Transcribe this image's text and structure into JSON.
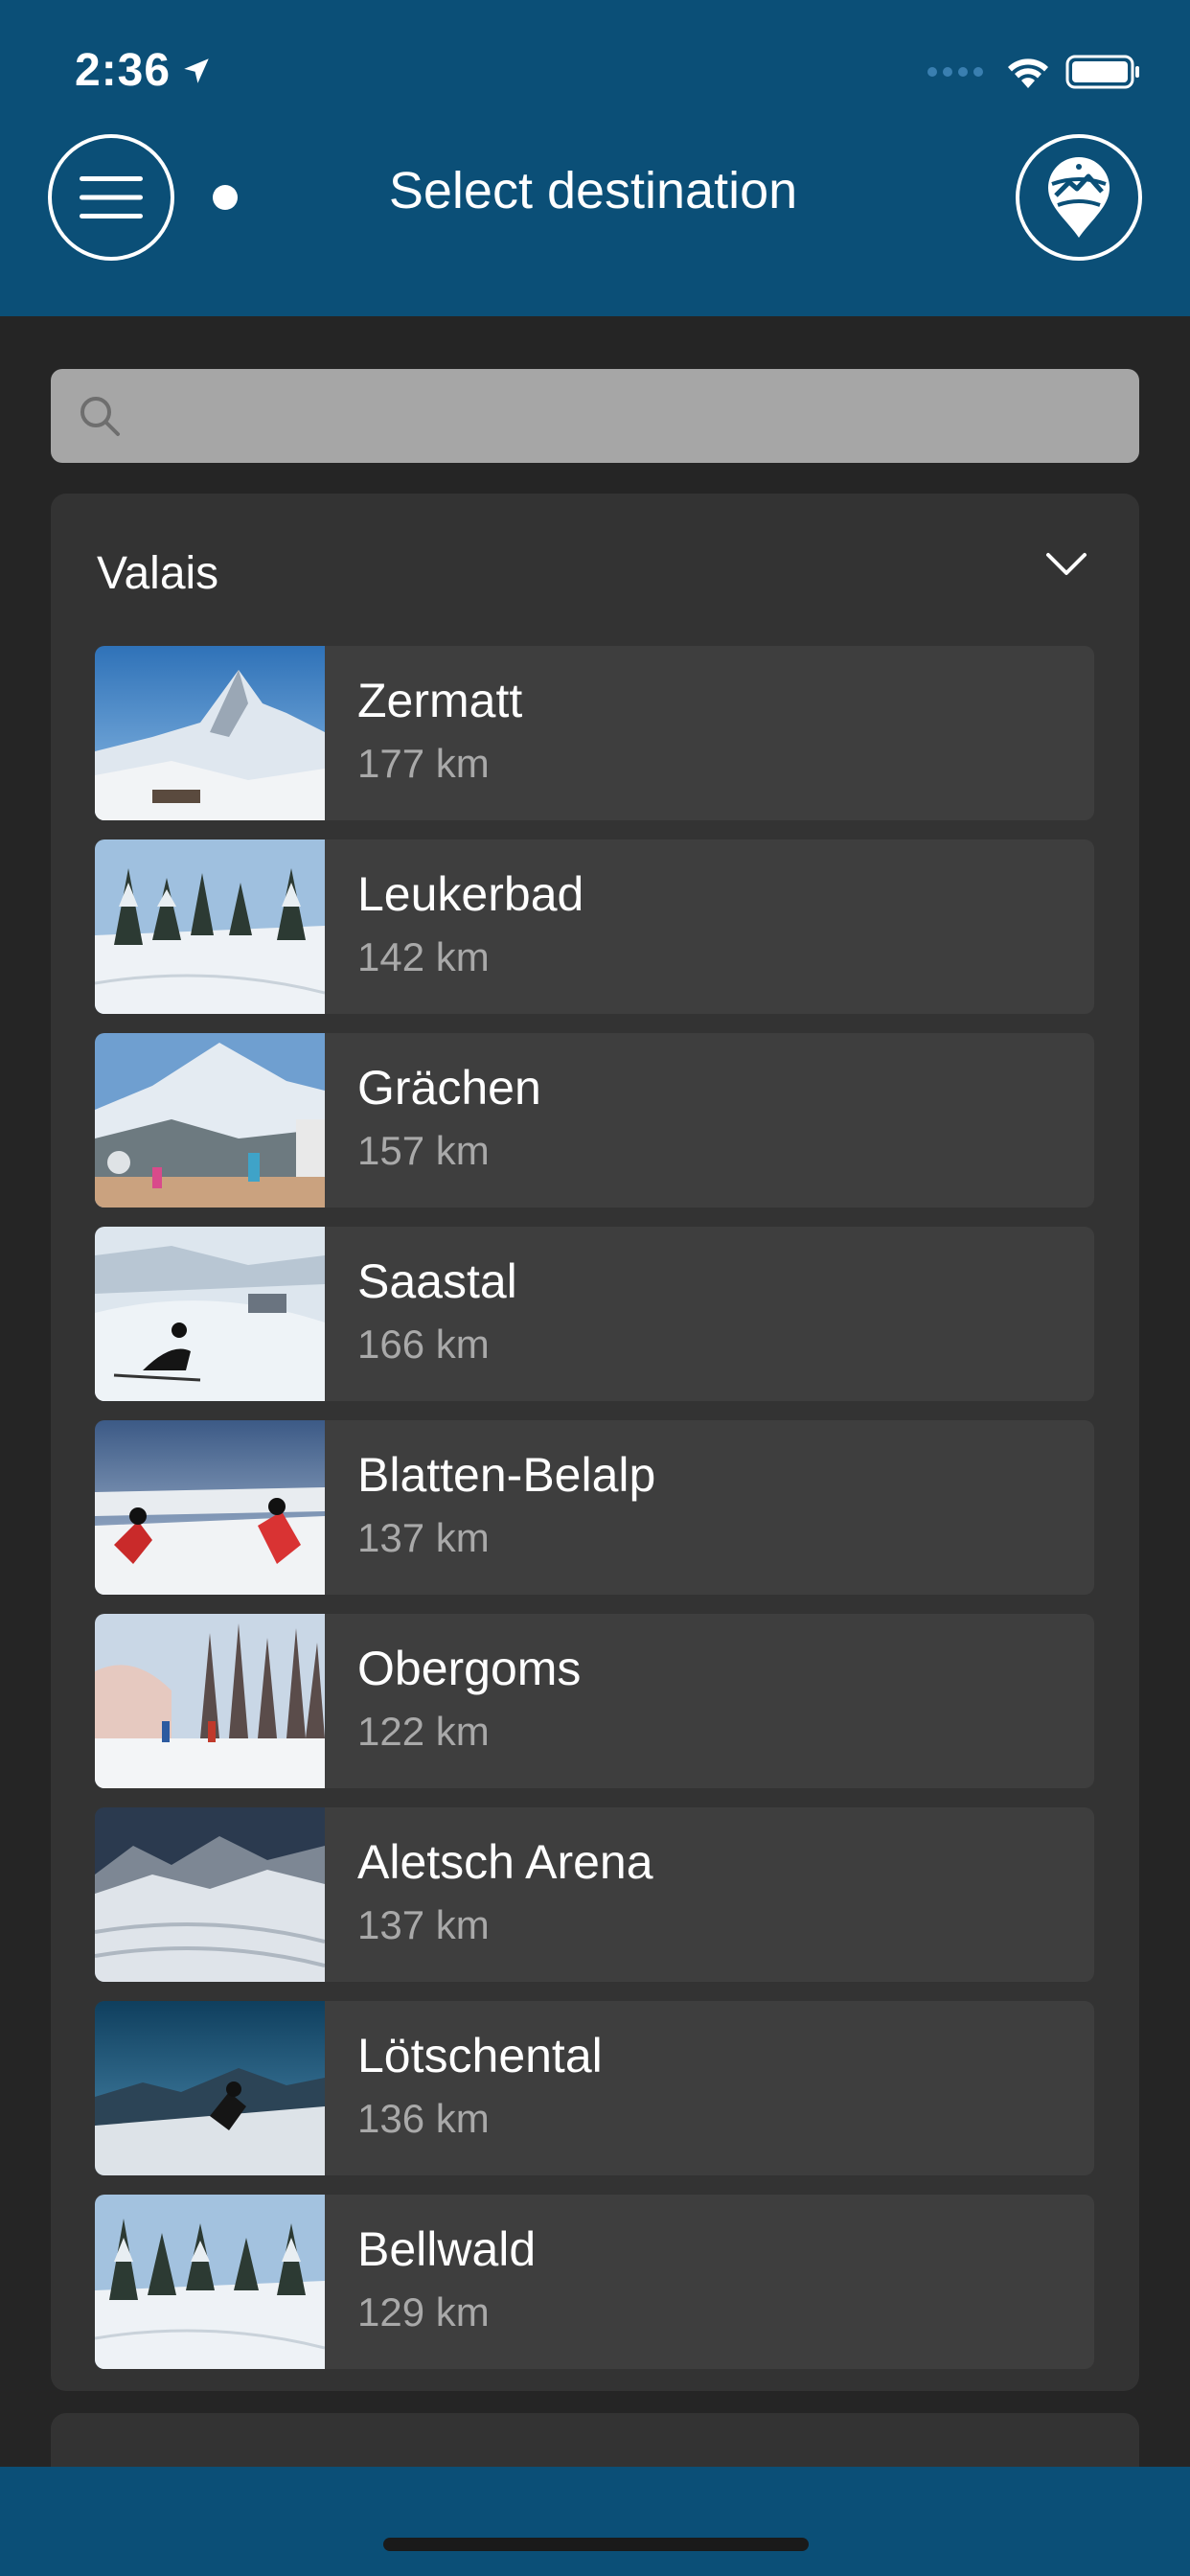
{
  "status": {
    "time": "2:36"
  },
  "header": {
    "title": "Select destination"
  },
  "search": {
    "placeholder": "",
    "value": ""
  },
  "region": {
    "name": "Valais",
    "destinations": [
      {
        "name": "Zermatt",
        "distance": "177 km",
        "image": "matterhorn-photo"
      },
      {
        "name": "Leukerbad",
        "distance": "142 km",
        "image": "snowy-forest-photo"
      },
      {
        "name": "Grächen",
        "distance": "157 km",
        "image": "mountain-terrace-photo"
      },
      {
        "name": "Saastal",
        "distance": "166 km",
        "image": "skier-slope-photo"
      },
      {
        "name": "Blatten-Belalp",
        "distance": "137 km",
        "image": "two-skiers-photo"
      },
      {
        "name": "Obergoms",
        "distance": "122 km",
        "image": "cross-country-photo"
      },
      {
        "name": "Aletsch Arena",
        "distance": "137 km",
        "image": "glacier-photo"
      },
      {
        "name": "Lötschental",
        "distance": "136 km",
        "image": "skier-sunset-photo"
      },
      {
        "name": "Bellwald",
        "distance": "129 km",
        "image": "snowy-forest-photo"
      }
    ]
  },
  "colors": {
    "header": "#0b4f77",
    "background": "#252525",
    "card": "#333333",
    "row": "#3e3e3e",
    "search": "#a6a6a6"
  }
}
